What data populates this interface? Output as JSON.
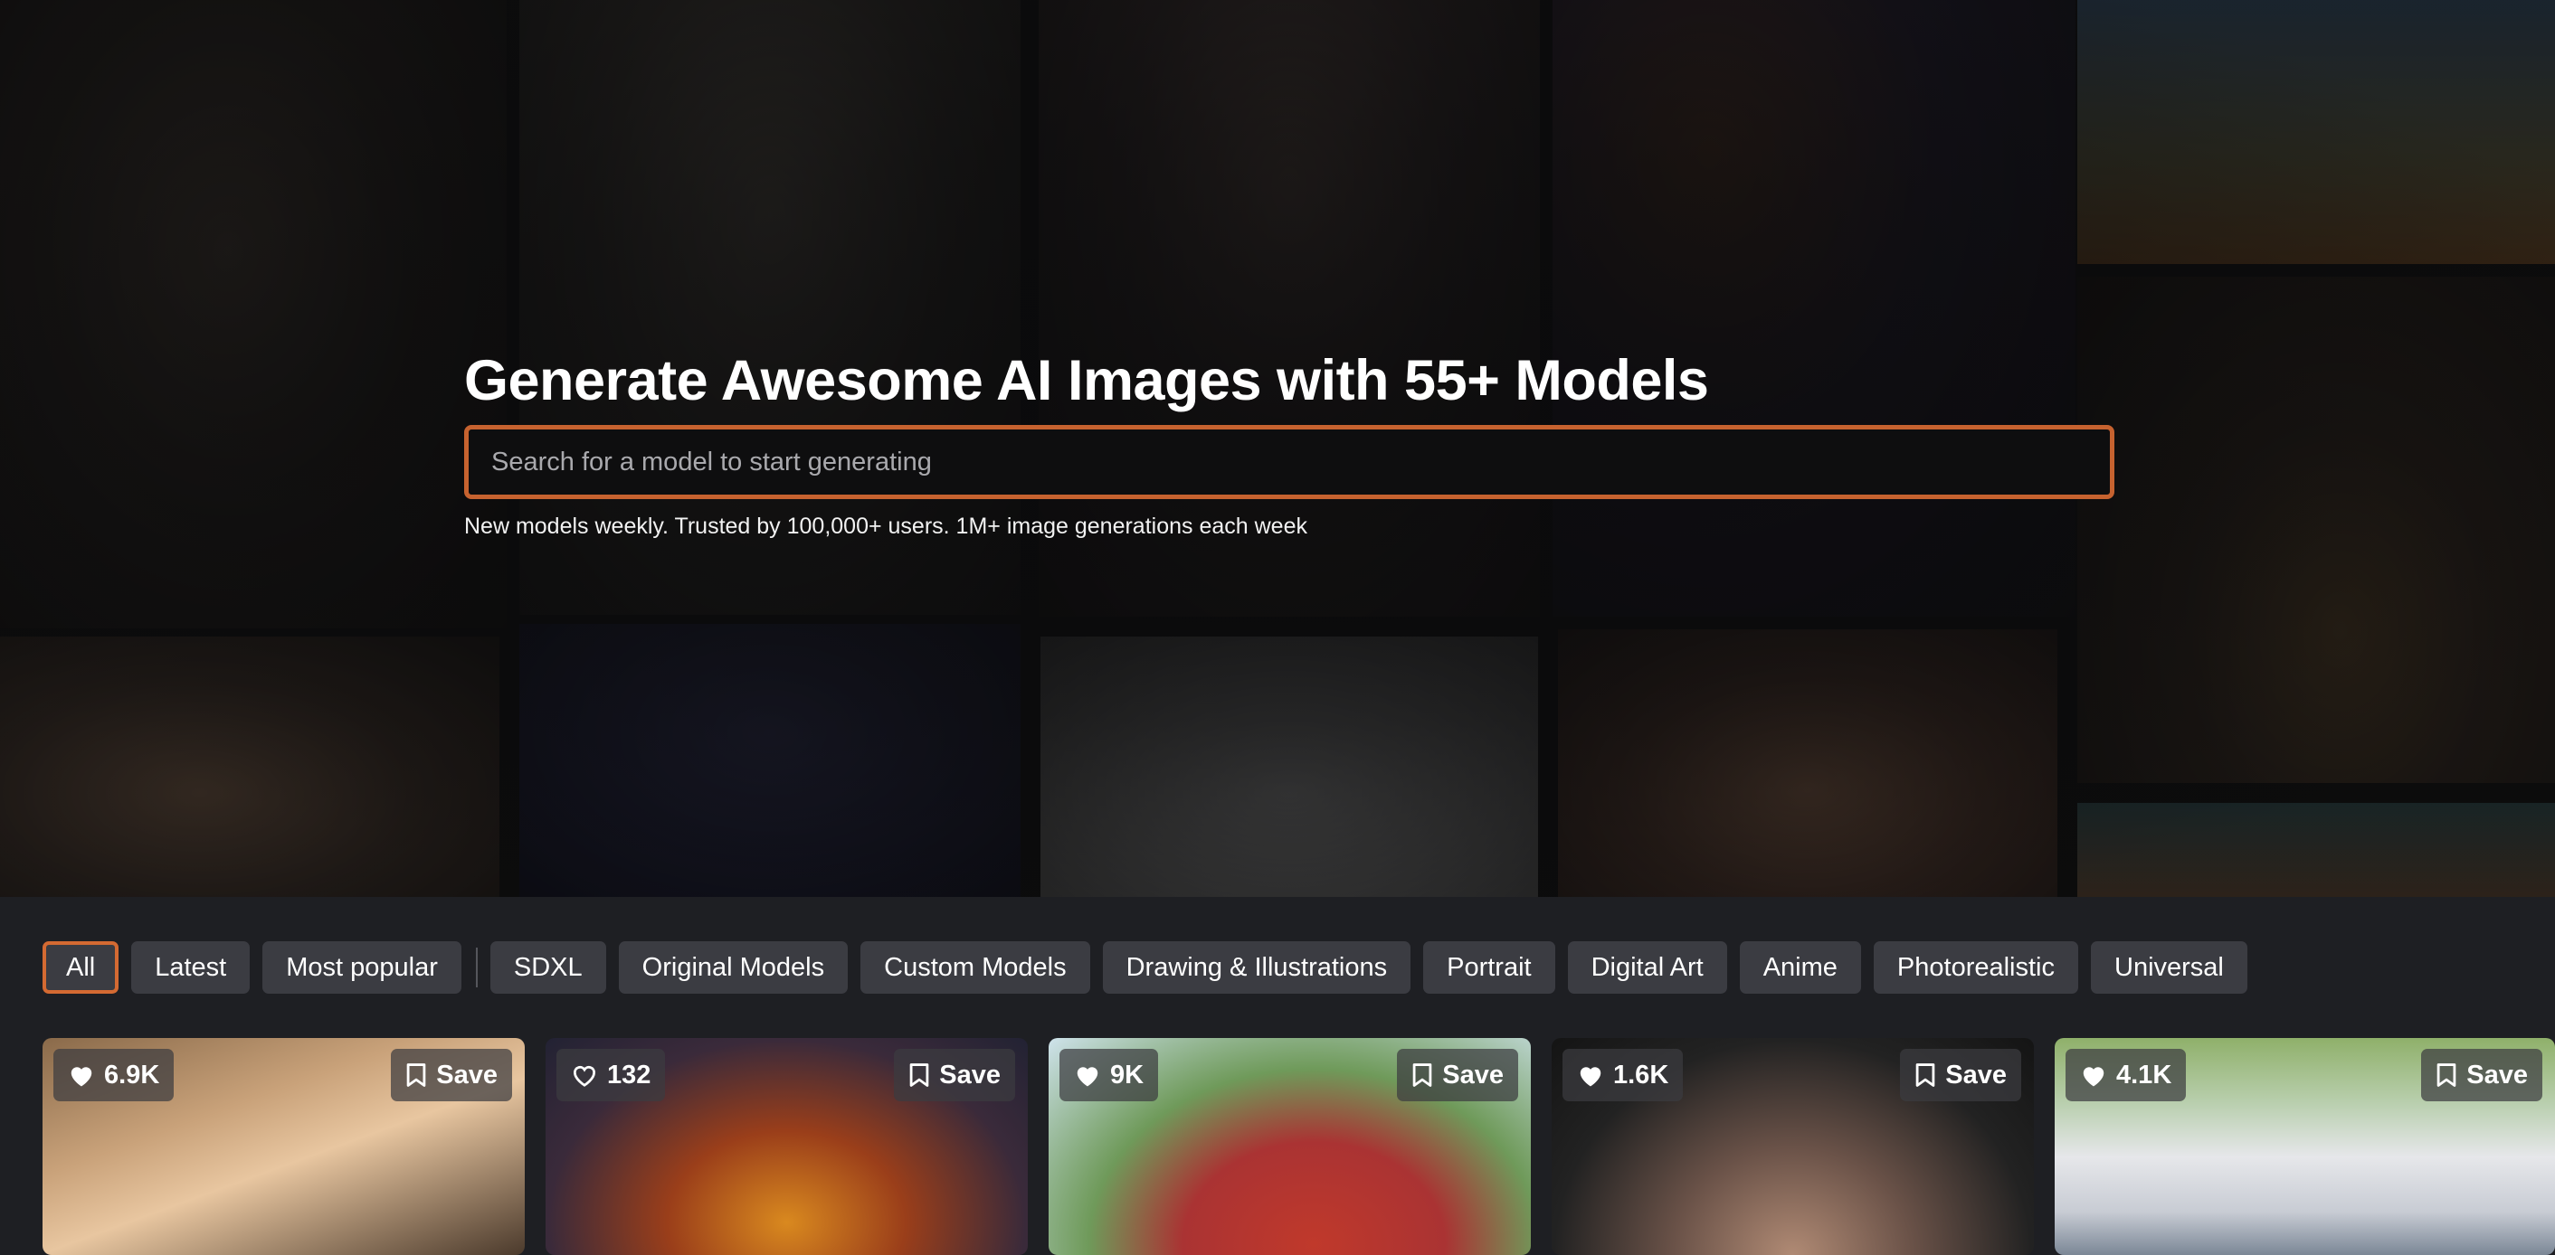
{
  "hero": {
    "title": "Generate Awesome AI Images with 55+ Models",
    "search_placeholder": "Search for a model to start generating",
    "tagline": "New models weekly. Trusted by 100,000+ users. 1M+ image generations each week"
  },
  "filters": [
    {
      "label": "All",
      "active": true
    },
    {
      "label": "Latest"
    },
    {
      "label": "Most popular"
    },
    {
      "label": "SDXL"
    },
    {
      "label": "Original Models"
    },
    {
      "label": "Custom Models"
    },
    {
      "label": "Drawing & Illustrations"
    },
    {
      "label": "Portrait"
    },
    {
      "label": "Digital Art"
    },
    {
      "label": "Anime"
    },
    {
      "label": "Photorealistic"
    },
    {
      "label": "Universal"
    }
  ],
  "cards": [
    {
      "likes": "6.9K",
      "save_label": "Save",
      "liked": true
    },
    {
      "likes": "132",
      "save_label": "Save",
      "liked": false
    },
    {
      "likes": "9K",
      "save_label": "Save",
      "liked": true
    },
    {
      "likes": "1.6K",
      "save_label": "Save",
      "liked": true
    },
    {
      "likes": "4.1K",
      "save_label": "Save",
      "liked": true
    }
  ],
  "colors": {
    "accent": "#d46a32",
    "chip_bg": "#3b3c42",
    "page_bg": "#1e1f23"
  },
  "icons": {
    "like": "heart-icon",
    "save": "bookmark-icon"
  }
}
